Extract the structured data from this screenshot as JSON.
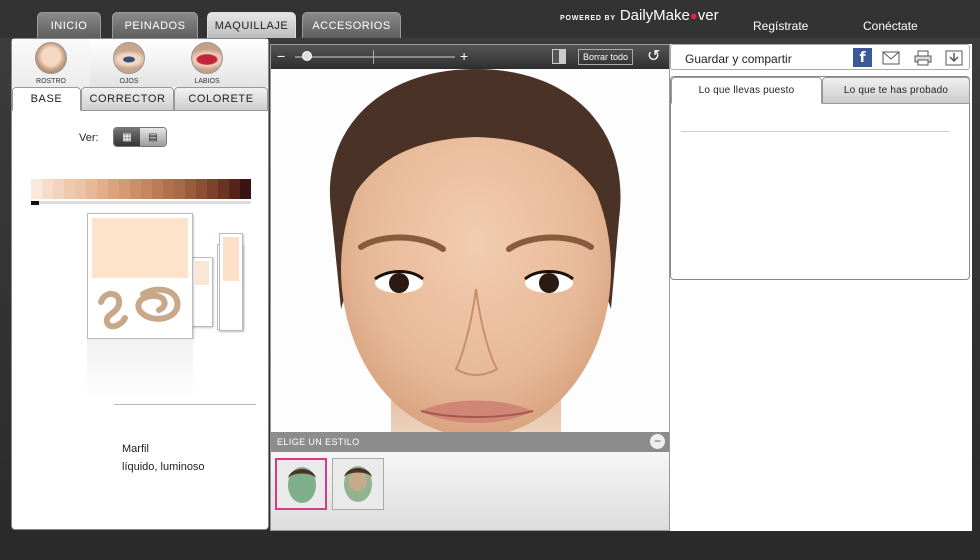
{
  "nav": {
    "tabs": [
      {
        "label": "INICIO"
      },
      {
        "label": "PEINADOS"
      },
      {
        "label": "MAQUILLAJE",
        "active": true
      },
      {
        "label": "ACCESORIOS"
      }
    ],
    "brand_prefix": "POWERED BY",
    "brand_name_a": "DailyMake",
    "brand_name_b": "ver",
    "register": "Regístrate",
    "login": "Conéctate"
  },
  "left": {
    "categories": [
      {
        "label": "ROSTRO",
        "icon": "face-icon"
      },
      {
        "label": "OJOS",
        "icon": "eye-icon"
      },
      {
        "label": "LABIOS",
        "icon": "lips-icon"
      }
    ],
    "subtabs": [
      {
        "label": "BASE"
      },
      {
        "label": "CORRECTOR"
      },
      {
        "label": "COLORETE"
      }
    ],
    "ver_label": "Ver:",
    "palette": [
      "#fbe8dc",
      "#f6dccb",
      "#f3d3bd",
      "#efc8ae",
      "#edc3a5",
      "#e8b898",
      "#e2ad89",
      "#dca27c",
      "#d59a74",
      "#cd8f68",
      "#c6865f",
      "#bc7a55",
      "#b2704d",
      "#a86a48",
      "#9c5b3c",
      "#8e4e33",
      "#7f4029",
      "#6d3322",
      "#56231a",
      "#3a1510"
    ],
    "product_name": "Marfil",
    "product_desc": "líquido, luminoso"
  },
  "center": {
    "clear_all": "Borrar todo",
    "style_title": "ELIGE UN ESTILO"
  },
  "right": {
    "share_label": "Guardar y compartir",
    "tab_worn": "Lo que llevas puesto",
    "tab_tried": "Lo que te has probado"
  }
}
